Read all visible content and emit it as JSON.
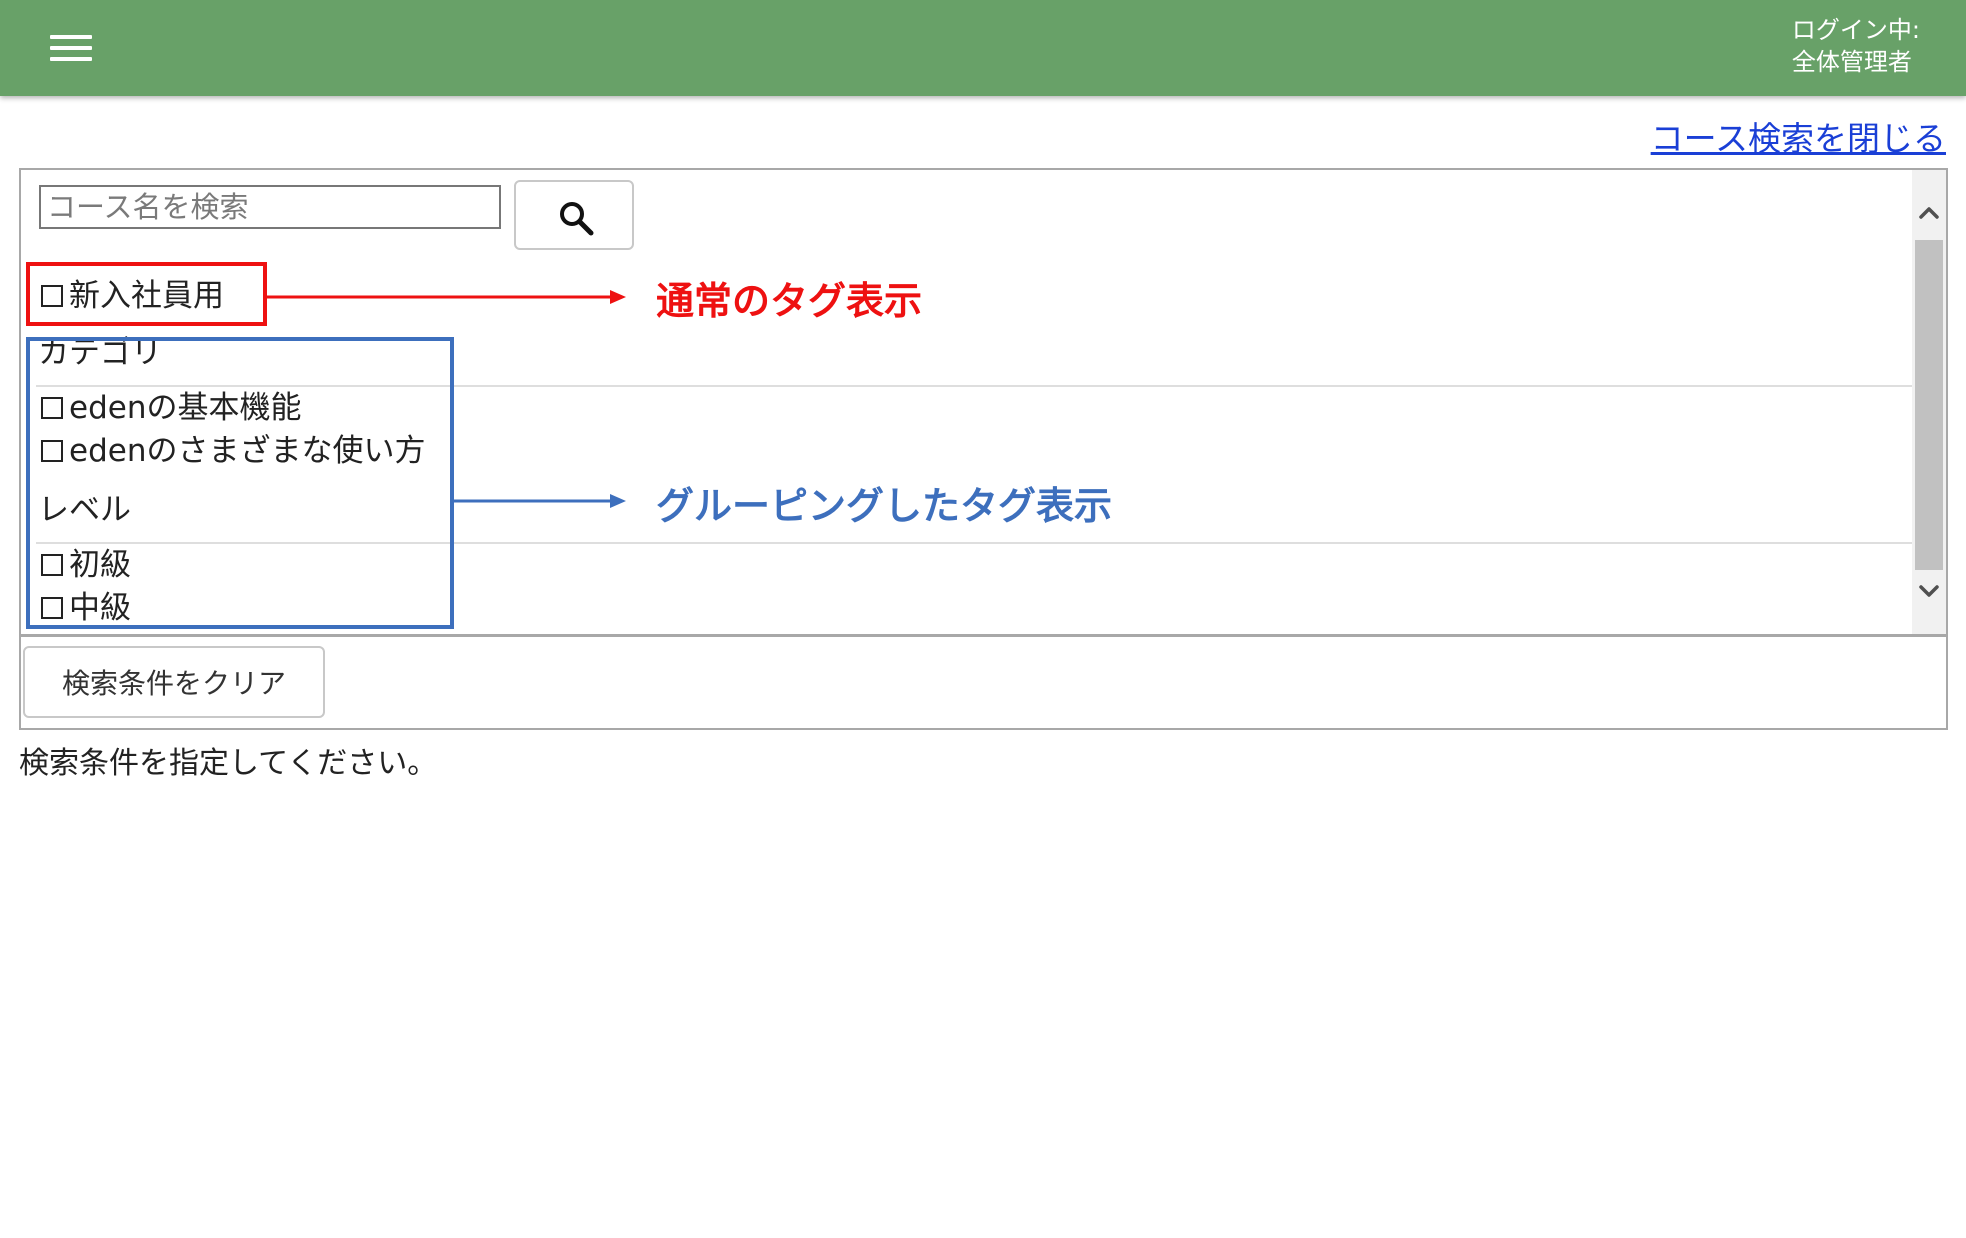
{
  "header": {
    "menu_icon": "hamburger-menu-icon",
    "login_line1": "ログイン中:",
    "login_line2": "全体管理者",
    "bg_color": "#68a168"
  },
  "close_link": "コース検索を閉じる",
  "search": {
    "placeholder": "コース名を検索",
    "value": "",
    "button_icon": "search-icon"
  },
  "tags": {
    "plain": [
      {
        "label": "新入社員用",
        "checked": false
      }
    ],
    "groups": [
      {
        "name": "カテゴリ",
        "items": [
          {
            "label": "edenの基本機能",
            "checked": false
          },
          {
            "label": "edenのさまざまな使い方",
            "checked": false
          }
        ]
      },
      {
        "name": "レベル",
        "items": [
          {
            "label": "初級",
            "checked": false
          },
          {
            "label": "中級",
            "checked": false
          }
        ]
      }
    ]
  },
  "clear_button": "検索条件をクリア",
  "status_text": "検索条件を指定してください。",
  "annotations": {
    "normal_tag": {
      "text": "通常のタグ表示",
      "color": "#ee1111"
    },
    "grouped_tag": {
      "text": "グルーピングしたタグ表示",
      "color": "#3d6fbd"
    }
  }
}
